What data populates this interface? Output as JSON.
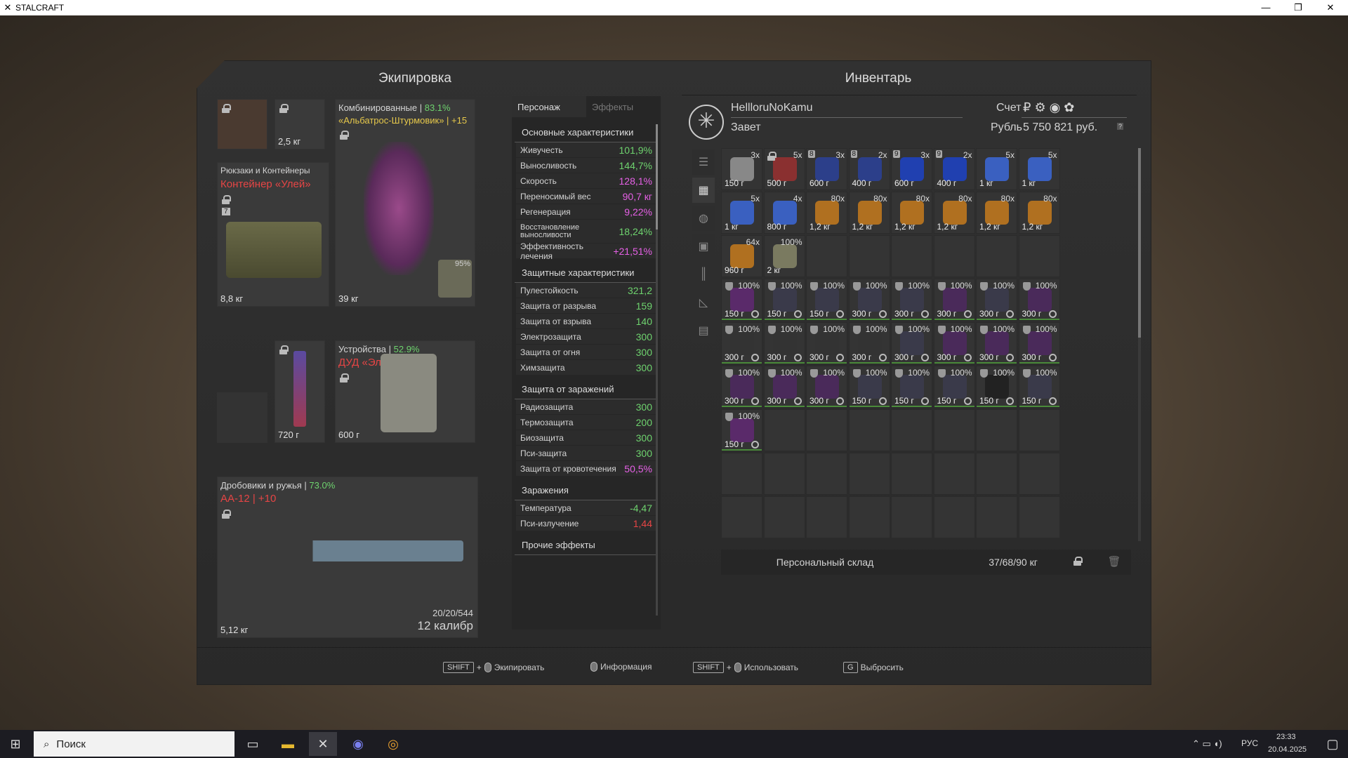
{
  "titlebar": {
    "title": "STALCRAFT",
    "minimize": "—",
    "restore": "❐",
    "close": "✕"
  },
  "equipment": {
    "header": "Экипировка",
    "face_weight": "",
    "nvg_weight": "2,5 кг",
    "backpack": {
      "category": "Рюкзаки и Контейнеры",
      "name": "Контейнер «Улей»",
      "slots": "7",
      "weight": "8,8 кг"
    },
    "armor": {
      "category": "Комбинированные",
      "percent": "83.1%",
      "name": "«Альбатрос-Штурмовик» | +15",
      "weight": "39 кг",
      "plate_percent": "95%"
    },
    "knife_weight": "720 г",
    "device": {
      "category": "Устройства",
      "percent": "52.9%",
      "name": "ДУД «Эльбрус»",
      "weight": "600 г"
    },
    "weapon": {
      "category": "Дробовики и ружья",
      "percent": "73.0%",
      "name": "АА-12 | +10",
      "weight": "5,12 кг",
      "ammo": "20/20/544",
      "caliber": "12 калибр"
    }
  },
  "stats": {
    "tab_character": "Персонаж",
    "tab_effects": "Эффекты",
    "basic_title": "Основные характеристики",
    "basic": [
      {
        "n": "Живучесть",
        "v": "101,9%",
        "c": "green"
      },
      {
        "n": "Выносливость",
        "v": "144,7%",
        "c": "green"
      },
      {
        "n": "Скорость",
        "v": "128,1%",
        "c": "pink"
      },
      {
        "n": "Переносимый вес",
        "v": "90,7 кг",
        "c": "pink"
      },
      {
        "n": "Регенерация",
        "v": "9,22%",
        "c": "pink"
      },
      {
        "n": "Восстановление выносливости",
        "v": "18,24%",
        "c": "green"
      },
      {
        "n": "Эффективность лечения",
        "v": "+21,51%",
        "c": "pink"
      }
    ],
    "defense_title": "Защитные характеристики",
    "defense": [
      {
        "n": "Пулестойкость",
        "v": "321,2",
        "c": "green"
      },
      {
        "n": "Защита от разрыва",
        "v": "159",
        "c": "green"
      },
      {
        "n": "Защита от взрыва",
        "v": "140",
        "c": "green"
      },
      {
        "n": "Электрозащита",
        "v": "300",
        "c": "green"
      },
      {
        "n": "Защита от огня",
        "v": "300",
        "c": "green"
      },
      {
        "n": "Химзащита",
        "v": "300",
        "c": "green"
      }
    ],
    "infection_title": "Защита от заражений",
    "infection": [
      {
        "n": "Радиозащита",
        "v": "300",
        "c": "green"
      },
      {
        "n": "Термозащита",
        "v": "200",
        "c": "green"
      },
      {
        "n": "Биозащита",
        "v": "300",
        "c": "green"
      },
      {
        "n": "Пси-защита",
        "v": "300",
        "c": "green"
      },
      {
        "n": "Защита от кровотечения",
        "v": "50,5%",
        "c": "pink"
      }
    ],
    "contam_title": "Заражения",
    "contam": [
      {
        "n": "Температура",
        "v": "-4,47",
        "c": "green"
      },
      {
        "n": "Пси-излучение",
        "v": "1,44",
        "c": "red"
      }
    ],
    "other_title": "Прочие эффекты"
  },
  "inventory": {
    "header": "Инвентарь",
    "player": "HellloruNoKamu",
    "faction": "Завет",
    "account_label": "Счет",
    "currency_label": "Рубль",
    "balance": "5 750 821 руб.",
    "help": "?",
    "storage_button": "Персональный склад",
    "weight": "37/68/90 кг",
    "items": [
      {
        "c": "3x",
        "w": "150 г",
        "col": "#888"
      },
      {
        "c": "5x",
        "w": "500 г",
        "col": "#8a3030",
        "lock": true
      },
      {
        "c": "3x",
        "w": "600 г",
        "col": "#2c3f8a",
        "tag": "8"
      },
      {
        "c": "2x",
        "w": "400 г",
        "col": "#2c3f8a",
        "tag": "8"
      },
      {
        "c": "3x",
        "w": "600 г",
        "col": "#2040b0",
        "tag": "9"
      },
      {
        "c": "2x",
        "w": "400 г",
        "col": "#2040b0",
        "tag": "9"
      },
      {
        "c": "5x",
        "w": "1 кг",
        "col": "#3a60c0"
      },
      {
        "c": "5x",
        "w": "1 кг",
        "col": "#3a60c0"
      },
      {
        "c": "5x",
        "w": "1 кг",
        "col": "#3a60c0"
      },
      {
        "c": "4x",
        "w": "800 г",
        "col": "#3a60c0"
      },
      {
        "c": "80x",
        "w": "1,2 кг",
        "col": "#b07020"
      },
      {
        "c": "80x",
        "w": "1,2 кг",
        "col": "#b07020"
      },
      {
        "c": "80x",
        "w": "1,2 кг",
        "col": "#b07020"
      },
      {
        "c": "80x",
        "w": "1,2 кг",
        "col": "#b07020"
      },
      {
        "c": "80x",
        "w": "1,2 кг",
        "col": "#b07020"
      },
      {
        "c": "80x",
        "w": "1,2 кг",
        "col": "#b07020"
      },
      {
        "c": "64x",
        "w": "960 г",
        "col": "#b07020"
      },
      {
        "c": "100%",
        "w": "2 кг",
        "col": "#7a7a60"
      },
      {},
      {},
      {},
      {},
      {},
      {},
      {
        "c": "100%",
        "w": "150 г",
        "col": "#5a2a6a",
        "art": true
      },
      {
        "c": "100%",
        "w": "150 г",
        "col": "#3a3a4a",
        "art": true
      },
      {
        "c": "100%",
        "w": "150 г",
        "col": "#3a3a4a",
        "art": true
      },
      {
        "c": "100%",
        "w": "300 г",
        "col": "#3a3a4a",
        "art": true
      },
      {
        "c": "100%",
        "w": "300 г",
        "col": "#3a3a4a",
        "art": true
      },
      {
        "c": "100%",
        "w": "300 г",
        "col": "#4a2a5a",
        "art": true
      },
      {
        "c": "100%",
        "w": "300 г",
        "col": "#3a3a4a",
        "art": true
      },
      {
        "c": "100%",
        "w": "300 г",
        "col": "#4a2a5a",
        "art": true
      },
      {
        "c": "100%",
        "w": "300 г",
        "col": "#333",
        "art": true
      },
      {
        "c": "100%",
        "w": "300 г",
        "col": "#333",
        "art": true
      },
      {
        "c": "100%",
        "w": "300 г",
        "col": "#333",
        "art": true
      },
      {
        "c": "100%",
        "w": "300 г",
        "col": "#333",
        "art": true
      },
      {
        "c": "100%",
        "w": "300 г",
        "col": "#3a3a4a",
        "art": true
      },
      {
        "c": "100%",
        "w": "300 г",
        "col": "#4a2a5a",
        "art": true
      },
      {
        "c": "100%",
        "w": "300 г",
        "col": "#4a2a5a",
        "art": true
      },
      {
        "c": "100%",
        "w": "300 г",
        "col": "#4a2a5a",
        "art": true
      },
      {
        "c": "100%",
        "w": "300 г",
        "col": "#4a2a5a",
        "art": true
      },
      {
        "c": "100%",
        "w": "300 г",
        "col": "#4a2a5a",
        "art": true
      },
      {
        "c": "100%",
        "w": "300 г",
        "col": "#4a2a5a",
        "art": true
      },
      {
        "c": "100%",
        "w": "150 г",
        "col": "#3a3a4a",
        "art": true
      },
      {
        "c": "100%",
        "w": "150 г",
        "col": "#3a3a4a",
        "art": true
      },
      {
        "c": "100%",
        "w": "150 г",
        "col": "#3a3a4a",
        "art": true
      },
      {
        "c": "100%",
        "w": "150 г",
        "col": "#222",
        "art": true
      },
      {
        "c": "100%",
        "w": "150 г",
        "col": "#3a3a4a",
        "art": true
      },
      {
        "c": "100%",
        "w": "150 г",
        "col": "#5a2a6a",
        "art": true
      }
    ]
  },
  "hints": {
    "shift": "SHIFT",
    "plus": "+",
    "equip": "Экипировать",
    "info": "Информация",
    "use": "Использовать",
    "g": "G",
    "drop": "Выбросить"
  },
  "taskbar": {
    "search": "Поиск",
    "lang": "РУС",
    "time": "23:33",
    "date": "20.04.2025"
  }
}
